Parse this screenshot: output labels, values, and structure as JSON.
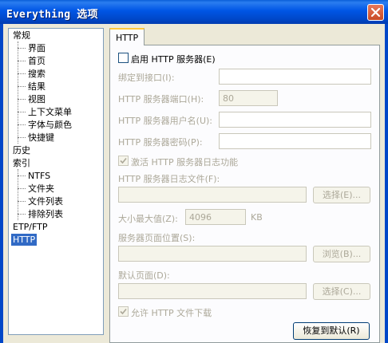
{
  "window": {
    "title": "Everything 选项",
    "close_icon": "close-icon"
  },
  "tree": {
    "items": [
      {
        "label": "常规"
      },
      {
        "label": "界面"
      },
      {
        "label": "首页"
      },
      {
        "label": "搜索"
      },
      {
        "label": "结果"
      },
      {
        "label": "视图"
      },
      {
        "label": "上下文菜单"
      },
      {
        "label": "字体与颜色"
      },
      {
        "label": "快捷键"
      },
      {
        "label": "历史"
      },
      {
        "label": "索引"
      },
      {
        "label": "NTFS"
      },
      {
        "label": "文件夹"
      },
      {
        "label": "文件列表"
      },
      {
        "label": "排除列表"
      },
      {
        "label": "ETP/FTP"
      },
      {
        "label": "HTTP",
        "selected": true
      }
    ]
  },
  "tab": {
    "label": "HTTP"
  },
  "http": {
    "enable_label": "启用 HTTP 服务器(E)",
    "enable_checked": false,
    "bind_label": "绑定到接口(I):",
    "bind_value": "",
    "port_label": "HTTP 服务器端口(H):",
    "port_value": "80",
    "username_label": "HTTP 服务器用户名(U):",
    "username_value": "",
    "password_label": "HTTP 服务器密码(P):",
    "password_value": "",
    "log_enable_label": "激活 HTTP 服务器日志功能",
    "log_enable_checked": true,
    "log_file_label": "HTTP 服务器日志文件(F):",
    "log_file_value": "",
    "log_browse_label": "选择(E)...",
    "max_size_label": "大小最大值(Z):",
    "max_size_value": "4096",
    "max_size_unit": "KB",
    "page_location_label": "服务器页面位置(S):",
    "page_location_value": "",
    "page_browse_label": "浏览(B)...",
    "default_page_label": "默认页面(D):",
    "default_page_value": "",
    "default_page_browse_label": "选择(C)...",
    "allow_download_label": "允许 HTTP 文件下载",
    "allow_download_checked": true,
    "restore_defaults_label": "恢复到默认(R)"
  }
}
